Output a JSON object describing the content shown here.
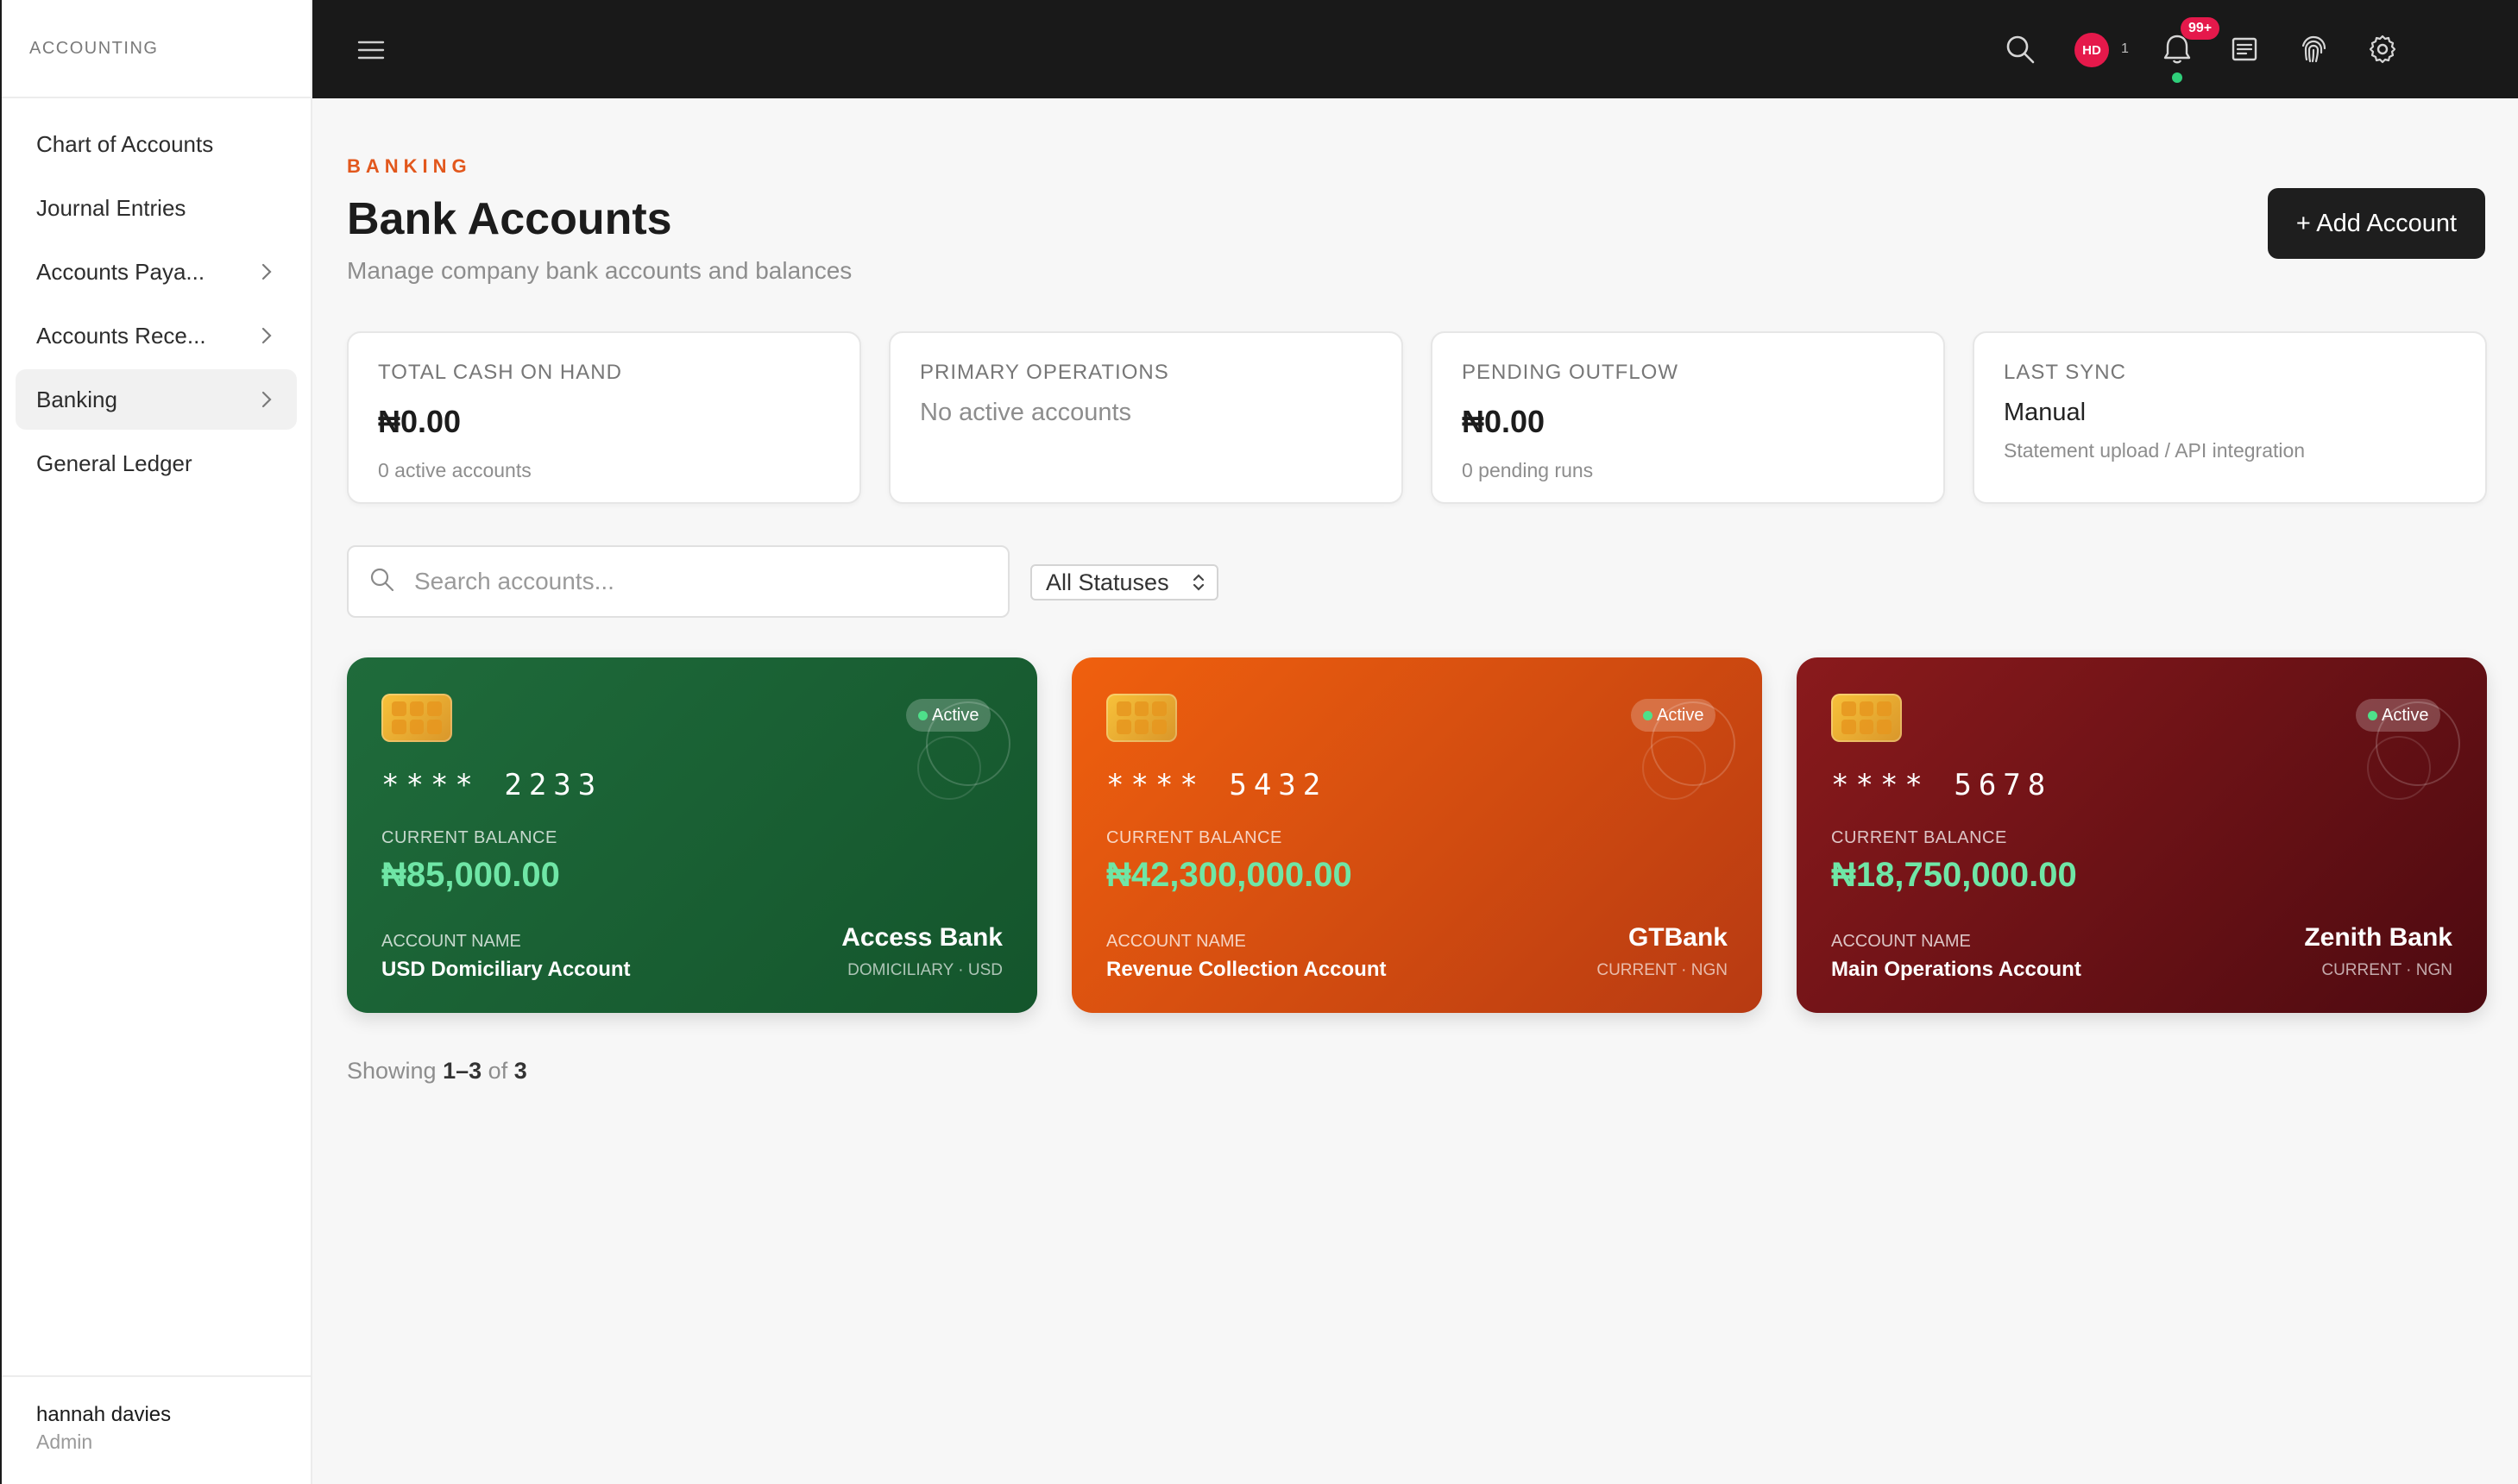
{
  "sidebar": {
    "section_title": "ACCOUNTING",
    "items": [
      {
        "label": "Chart of Accounts"
      },
      {
        "label": "Journal Entries"
      },
      {
        "label": "Accounts Paya..."
      },
      {
        "label": "Accounts Rece..."
      },
      {
        "label": "Banking"
      },
      {
        "label": "General Ledger"
      }
    ],
    "user": {
      "name": "hannah davies",
      "role": "Admin"
    }
  },
  "topbar": {
    "avatar_initials": "HD",
    "avatar_count": "1",
    "notification_badge": "99+"
  },
  "header": {
    "eyebrow": "BANKING",
    "title": "Bank Accounts",
    "subtitle": "Manage company bank accounts and balances",
    "add_button": "+ Add Account"
  },
  "stats": [
    {
      "label": "TOTAL CASH ON HAND",
      "value": "₦0.00",
      "note": "0 active accounts"
    },
    {
      "label": "PRIMARY OPERATIONS",
      "value": "No active accounts"
    },
    {
      "label": "PENDING OUTFLOW",
      "value": "₦0.00",
      "note": "0 pending runs"
    },
    {
      "label": "LAST SYNC",
      "value": "Manual",
      "note": "Statement upload / API integration"
    }
  ],
  "filters": {
    "search_placeholder": "Search accounts...",
    "status_selected": "All Statuses"
  },
  "cards": [
    {
      "status": "Active",
      "masked_number": "**** 2233",
      "balance_label": "CURRENT BALANCE",
      "balance": "₦85,000.00",
      "account_name_label": "ACCOUNT NAME",
      "account_name": "USD Domiciliary Account",
      "bank": "Access Bank",
      "type": "DOMICILIARY · USD",
      "color": "#1f6b3b"
    },
    {
      "status": "Active",
      "masked_number": "**** 5432",
      "balance_label": "CURRENT BALANCE",
      "balance": "₦42,300,000.00",
      "account_name_label": "ACCOUNT NAME",
      "account_name": "Revenue Collection Account",
      "bank": "GTBank",
      "type": "CURRENT · NGN",
      "color": "#f0600e"
    },
    {
      "status": "Active",
      "masked_number": "**** 5678",
      "balance_label": "CURRENT BALANCE",
      "balance": "₦18,750,000.00",
      "account_name_label": "ACCOUNT NAME",
      "account_name": "Main Operations Account",
      "bank": "Zenith Bank",
      "type": "CURRENT · NGN",
      "color": "#8a1a1c"
    }
  ],
  "pagination": {
    "prefix": "Showing",
    "range": "1–3",
    "of": "of",
    "total": "3"
  },
  "colors": {
    "accent": "#e2571c",
    "topbar": "#191919",
    "badge": "#e5194b",
    "balance": "#6fe6a6",
    "online": "#2fcf7a"
  }
}
